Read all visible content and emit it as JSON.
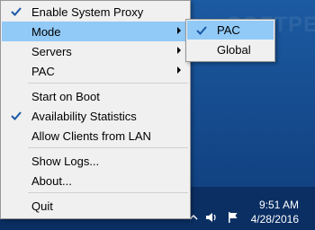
{
  "watermark": "SOFTPEDIA",
  "menu": {
    "enable_proxy": "Enable System Proxy",
    "mode": "Mode",
    "servers": "Servers",
    "pac": "PAC",
    "start_on_boot": "Start on Boot",
    "availability": "Availability Statistics",
    "allow_lan": "Allow Clients from LAN",
    "show_logs": "Show Logs...",
    "about": "About...",
    "quit": "Quit"
  },
  "submenu": {
    "pac": "PAC",
    "global": "Global"
  },
  "clock": {
    "time": "9:51 AM",
    "date": "4/28/2016"
  }
}
